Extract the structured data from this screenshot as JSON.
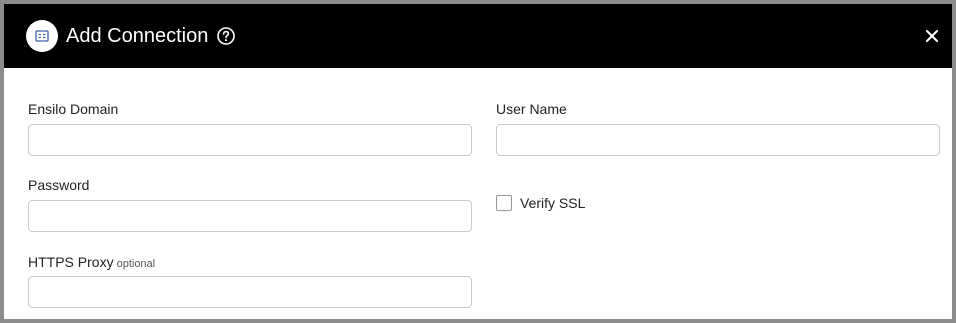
{
  "dialog": {
    "title": "Add Connection",
    "icon": "integration-app-icon",
    "help_icon": "help-circle-icon",
    "close_icon": "close-icon"
  },
  "form": {
    "ensilo_domain": {
      "label": "Ensilo Domain",
      "value": "",
      "placeholder": ""
    },
    "user_name": {
      "label": "User Name",
      "value": "",
      "placeholder": ""
    },
    "password": {
      "label": "Password",
      "value": "",
      "placeholder": ""
    },
    "verify_ssl": {
      "label": "Verify SSL",
      "checked": false
    },
    "https_proxy": {
      "label": "HTTPS Proxy",
      "hint": "optional",
      "value": "",
      "placeholder": ""
    }
  },
  "colors": {
    "header_bg": "#000000",
    "header_text": "#ffffff",
    "input_border": "#cccccc",
    "frame_border": "#8c8c8c"
  }
}
